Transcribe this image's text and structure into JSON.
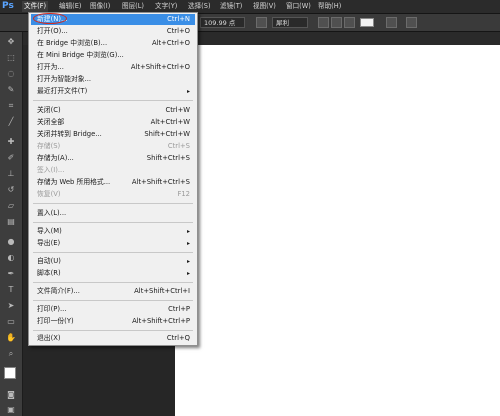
{
  "app": {
    "logo": "Ps"
  },
  "menubar": {
    "items": [
      "文件(F)",
      "编辑(E)",
      "图像(I)",
      "图层(L)",
      "文字(Y)",
      "选择(S)",
      "滤镜(T)",
      "视图(V)",
      "窗口(W)",
      "帮助(H)"
    ]
  },
  "options": {
    "size_value": "109.99 点",
    "antialias_value": "犀利"
  },
  "file_menu": {
    "items": [
      {
        "label": "新建(N)...",
        "shortcut": "Ctrl+N"
      },
      {
        "label": "打开(O)...",
        "shortcut": "Ctrl+O"
      },
      {
        "label": "在 Bridge 中浏览(B)...",
        "shortcut": "Alt+Ctrl+O"
      },
      {
        "label": "在 Mini Bridge 中浏览(G)...",
        "shortcut": ""
      },
      {
        "label": "打开为...",
        "shortcut": "Alt+Shift+Ctrl+O"
      },
      {
        "label": "打开为智能对象...",
        "shortcut": ""
      },
      {
        "label": "最近打开文件(T)",
        "shortcut": ""
      },
      {
        "label": "关闭(C)",
        "shortcut": "Ctrl+W"
      },
      {
        "label": "关闭全部",
        "shortcut": "Alt+Ctrl+W"
      },
      {
        "label": "关闭并转到 Bridge...",
        "shortcut": "Shift+Ctrl+W"
      },
      {
        "label": "存储(S)",
        "shortcut": "Ctrl+S"
      },
      {
        "label": "存储为(A)...",
        "shortcut": "Shift+Ctrl+S"
      },
      {
        "label": "签入(I)...",
        "shortcut": ""
      },
      {
        "label": "存储为 Web 所用格式...",
        "shortcut": "Alt+Shift+Ctrl+S"
      },
      {
        "label": "恢复(V)",
        "shortcut": "F12"
      },
      {
        "label": "置入(L)...",
        "shortcut": ""
      },
      {
        "label": "导入(M)",
        "shortcut": ""
      },
      {
        "label": "导出(E)",
        "shortcut": ""
      },
      {
        "label": "自动(U)",
        "shortcut": ""
      },
      {
        "label": "脚本(R)",
        "shortcut": ""
      },
      {
        "label": "文件简介(F)...",
        "shortcut": "Alt+Shift+Ctrl+I"
      },
      {
        "label": "打印(P)...",
        "shortcut": "Ctrl+P"
      },
      {
        "label": "打印一份(Y)",
        "shortcut": "Alt+Shift+Ctrl+P"
      },
      {
        "label": "退出(X)",
        "shortcut": "Ctrl+Q"
      }
    ],
    "submenu_arrow": "▸"
  },
  "colors": {
    "highlight": "#3a8ee6",
    "ring": "#d22a1e"
  }
}
